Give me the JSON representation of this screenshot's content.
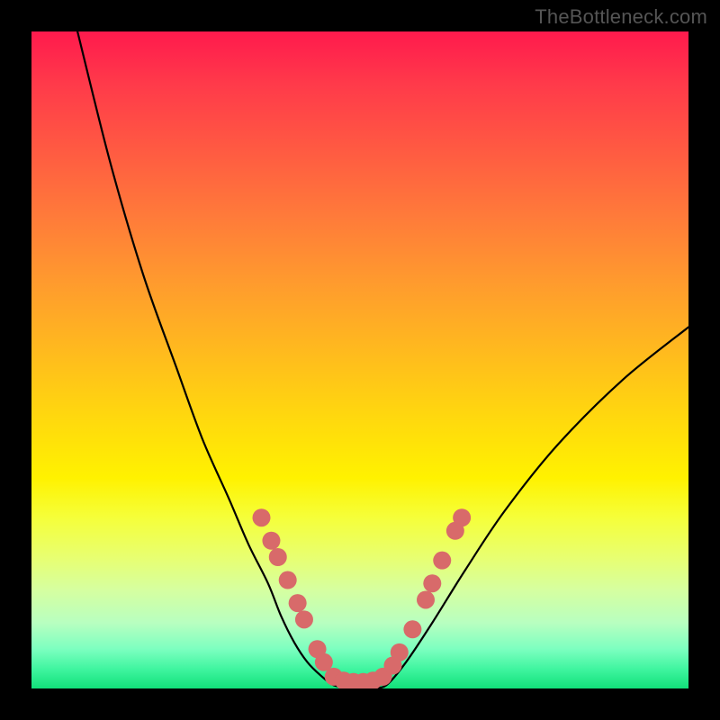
{
  "watermark": "TheBottleneck.com",
  "chart_data": {
    "type": "line",
    "title": "",
    "xlabel": "",
    "ylabel": "",
    "xlim": [
      0,
      100
    ],
    "ylim": [
      0,
      100
    ],
    "grid": false,
    "series": [
      {
        "name": "left-branch",
        "x": [
          7,
          12,
          17,
          22,
          26,
          30,
          33,
          36,
          38,
          40,
          42,
          44,
          46
        ],
        "y": [
          100,
          80,
          63,
          49,
          38,
          29,
          22,
          16,
          11,
          7,
          4,
          2,
          0.5
        ],
        "color": "#000000"
      },
      {
        "name": "valley-floor",
        "x": [
          46,
          48,
          50,
          52,
          54
        ],
        "y": [
          0.5,
          0.2,
          0.2,
          0.2,
          0.5
        ],
        "color": "#000000"
      },
      {
        "name": "right-branch",
        "x": [
          54,
          57,
          61,
          66,
          72,
          80,
          90,
          100
        ],
        "y": [
          0.5,
          4,
          10,
          18,
          27,
          37,
          47,
          55
        ],
        "color": "#000000"
      }
    ],
    "markers": {
      "name": "data-points",
      "color": "#d86a6a",
      "radius": 10,
      "points": [
        {
          "x": 35.0,
          "y": 26.0
        },
        {
          "x": 36.5,
          "y": 22.5
        },
        {
          "x": 37.5,
          "y": 20.0
        },
        {
          "x": 39.0,
          "y": 16.5
        },
        {
          "x": 40.5,
          "y": 13.0
        },
        {
          "x": 41.5,
          "y": 10.5
        },
        {
          "x": 43.5,
          "y": 6.0
        },
        {
          "x": 44.5,
          "y": 4.0
        },
        {
          "x": 46.0,
          "y": 1.8
        },
        {
          "x": 47.5,
          "y": 1.2
        },
        {
          "x": 49.0,
          "y": 1.0
        },
        {
          "x": 50.5,
          "y": 1.0
        },
        {
          "x": 52.0,
          "y": 1.2
        },
        {
          "x": 53.5,
          "y": 1.8
        },
        {
          "x": 55.0,
          "y": 3.5
        },
        {
          "x": 56.0,
          "y": 5.5
        },
        {
          "x": 58.0,
          "y": 9.0
        },
        {
          "x": 60.0,
          "y": 13.5
        },
        {
          "x": 61.0,
          "y": 16.0
        },
        {
          "x": 62.5,
          "y": 19.5
        },
        {
          "x": 64.5,
          "y": 24.0
        },
        {
          "x": 65.5,
          "y": 26.0
        }
      ]
    }
  }
}
